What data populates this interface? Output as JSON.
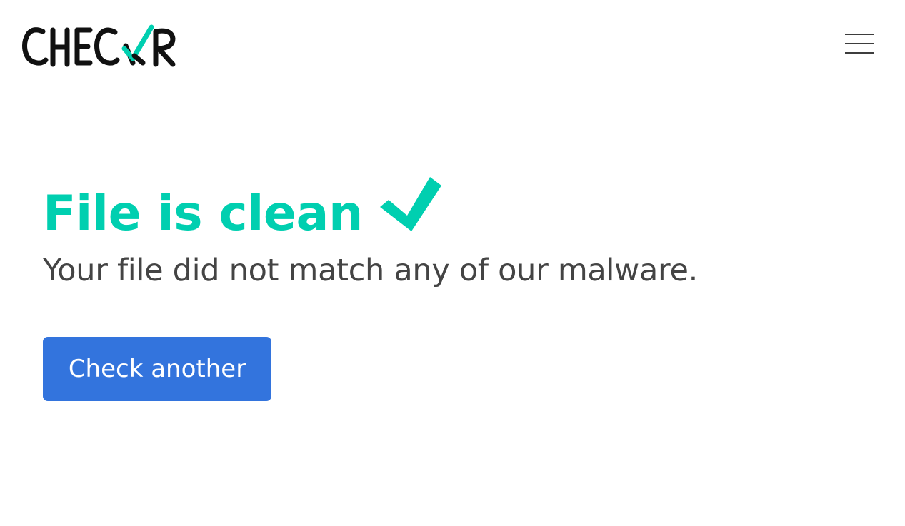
{
  "header": {
    "logo_text": "CHECKR",
    "menu_icon": "hamburger-menu-icon"
  },
  "result": {
    "title": "File is clean",
    "status_icon": "checkmark-icon",
    "subtitle": "Your file did not match any of our malware."
  },
  "actions": {
    "check_another_label": "Check another"
  },
  "colors": {
    "accent": "#00cfb0",
    "button": "#3374dd",
    "text": "#444444",
    "logo": "#111111"
  }
}
